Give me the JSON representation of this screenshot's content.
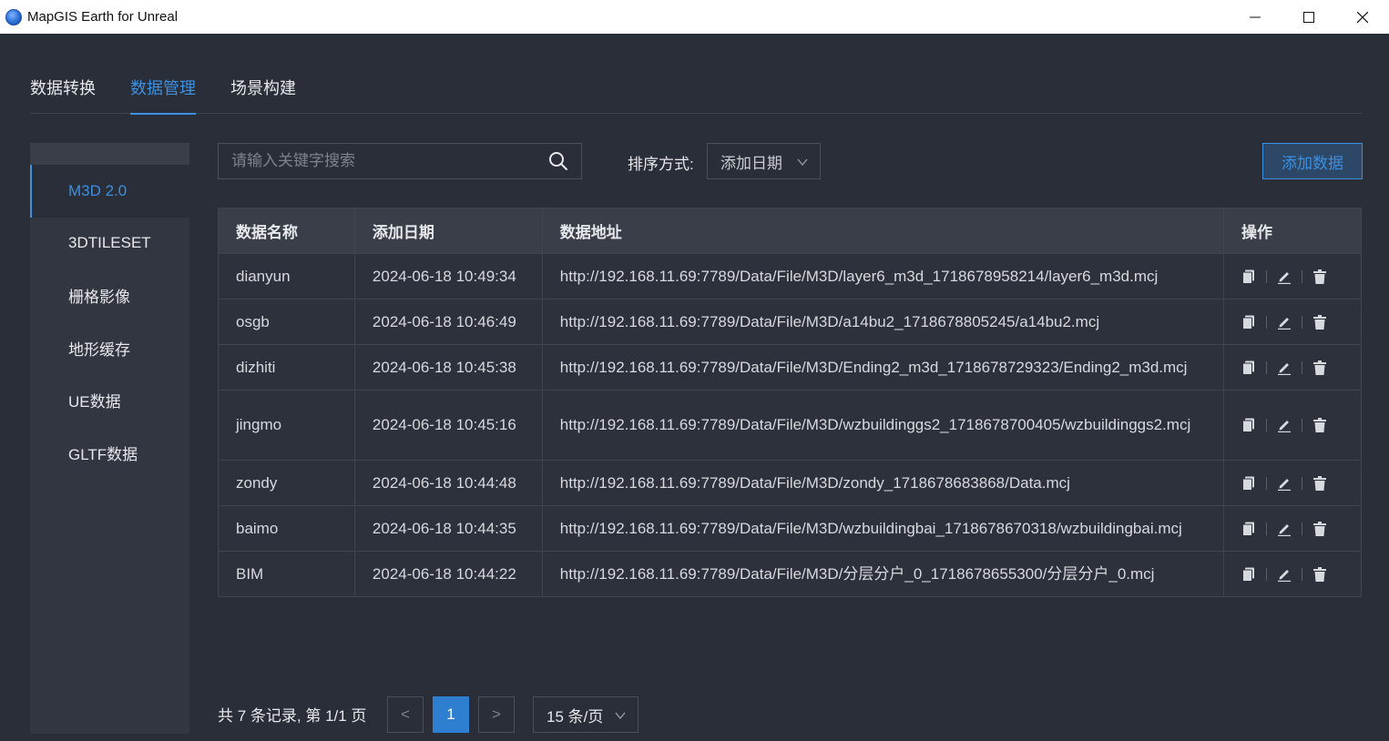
{
  "window": {
    "title": "MapGIS Earth for Unreal",
    "minimize_glyph": "—",
    "maximize_glyph": "☐",
    "close_glyph": "✕"
  },
  "tabs": [
    {
      "label": "数据转换",
      "active": false
    },
    {
      "label": "数据管理",
      "active": true
    },
    {
      "label": "场景构建",
      "active": false
    }
  ],
  "sidebar": {
    "items": [
      {
        "label": "M3D 2.0",
        "active": true
      },
      {
        "label": "3DTILESET",
        "active": false
      },
      {
        "label": "栅格影像",
        "active": false
      },
      {
        "label": "地形缓存",
        "active": false
      },
      {
        "label": "UE数据",
        "active": false
      },
      {
        "label": "GLTF数据",
        "active": false
      }
    ]
  },
  "toolbar": {
    "search_placeholder": "请输入关键字搜索",
    "sort_label": "排序方式:",
    "sort_value": "添加日期",
    "add_button": "添加数据"
  },
  "table": {
    "headers": [
      "数据名称",
      "添加日期",
      "数据地址",
      "操作"
    ],
    "rows": [
      {
        "name": "dianyun",
        "date": "2024-06-18 10:49:34",
        "address": "http://192.168.11.69:7789/Data/File/M3D/layer6_m3d_1718678958214/layer6_m3d.mcj"
      },
      {
        "name": "osgb",
        "date": "2024-06-18 10:46:49",
        "address": "http://192.168.11.69:7789/Data/File/M3D/a14bu2_1718678805245/a14bu2.mcj"
      },
      {
        "name": "dizhiti",
        "date": "2024-06-18 10:45:38",
        "address": "http://192.168.11.69:7789/Data/File/M3D/Ending2_m3d_1718678729323/Ending2_m3d.mcj"
      },
      {
        "name": "jingmo",
        "date": "2024-06-18 10:45:16",
        "address": "http://192.168.11.69:7789/Data/File/M3D/wzbuildinggs2_1718678700405/wzbuildinggs2.mcj"
      },
      {
        "name": "zondy",
        "date": "2024-06-18 10:44:48",
        "address": "http://192.168.11.69:7789/Data/File/M3D/zondy_1718678683868/Data.mcj"
      },
      {
        "name": "baimo",
        "date": "2024-06-18 10:44:35",
        "address": "http://192.168.11.69:7789/Data/File/M3D/wzbuildingbai_1718678670318/wzbuildingbai.mcj"
      },
      {
        "name": "BIM",
        "date": "2024-06-18 10:44:22",
        "address": "http://192.168.11.69:7789/Data/File/M3D/分层分户_0_1718678655300/分层分户_0.mcj"
      }
    ],
    "row_actions": [
      "copy-icon",
      "edit-icon",
      "delete-icon"
    ]
  },
  "pagination": {
    "summary": "共 7 条记录, 第 1/1 页",
    "prev_glyph": "<",
    "current_page": "1",
    "next_glyph": ">",
    "page_size": "15 条/页"
  },
  "colors": {
    "background": "#2a2e38",
    "accent": "#3d8fe0",
    "panel": "#323640",
    "table_header": "#3a3e48",
    "border": "#3f4450"
  }
}
